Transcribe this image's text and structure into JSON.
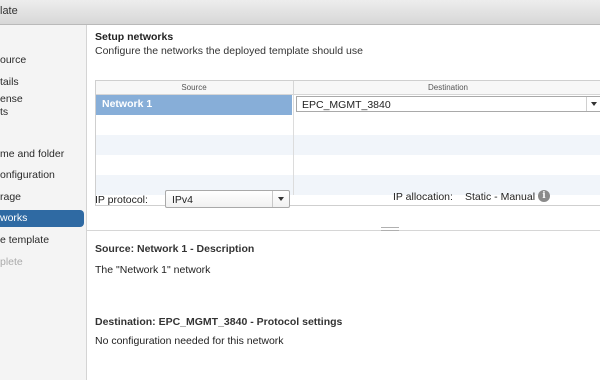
{
  "window": {
    "title": "late"
  },
  "nav": {
    "items": [
      {
        "label": "ource",
        "state": "normal"
      },
      {
        "label": "tails",
        "state": "normal"
      },
      {
        "label": "ense",
        "state": "normal"
      },
      {
        "label": "ts",
        "state": "normal"
      },
      {
        "label": "me and folder",
        "state": "normal"
      },
      {
        "label": "onfiguration",
        "state": "normal"
      },
      {
        "label": "rage",
        "state": "normal"
      },
      {
        "label": "works",
        "state": "active"
      },
      {
        "label": "e template",
        "state": "normal"
      },
      {
        "label": "plete",
        "state": "disabled"
      }
    ]
  },
  "main": {
    "title": "Setup networks",
    "subtitle": "Configure the networks the deployed template should use",
    "table": {
      "headers": {
        "source": "Source",
        "destination": "Destination"
      },
      "rows": [
        {
          "source": "Network 1",
          "destination": "EPC_MGMT_3840",
          "selected": true
        }
      ]
    },
    "ip_protocol": {
      "label": "IP protocol:",
      "value": "IPv4"
    },
    "ip_allocation": {
      "label": "IP allocation:",
      "value": "Static - Manual",
      "icon": "info-icon"
    },
    "description": {
      "title": "Source: Network 1 - Description",
      "text": "The \"Network 1\" network"
    },
    "protocol_settings": {
      "title": "Destination: EPC_MGMT_3840 - Protocol settings",
      "text": "No configuration needed for this network"
    }
  },
  "colors": {
    "accent": "#2f6aa3",
    "selection": "#87aed8",
    "alt_row": "#f1f5fa"
  }
}
